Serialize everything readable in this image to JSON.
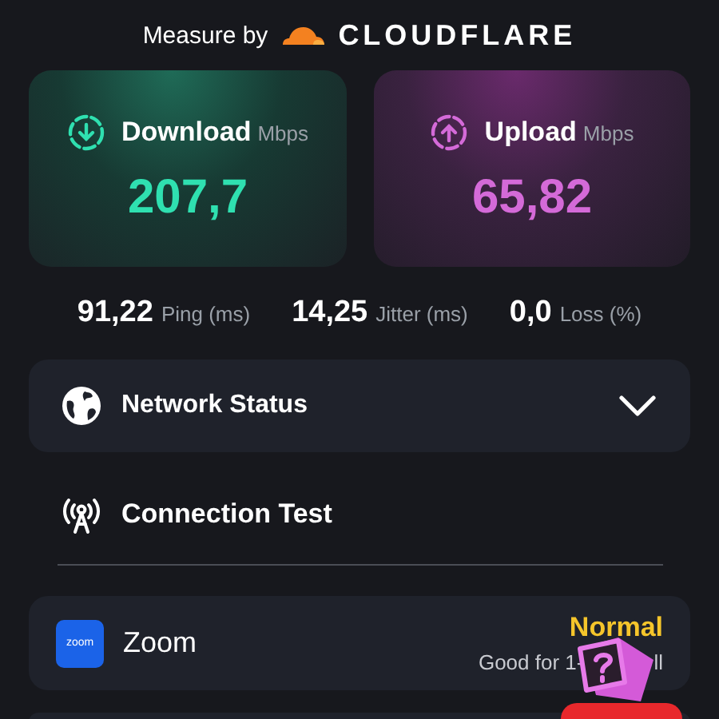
{
  "header": {
    "prefix": "Measure by",
    "brand": "CLOUDFLARE"
  },
  "speeds": [
    {
      "kind": "download",
      "label": "Download",
      "unit": "Mbps",
      "value": "207,7"
    },
    {
      "kind": "upload",
      "label": "Upload",
      "unit": "Mbps",
      "value": "65,82"
    }
  ],
  "stats": [
    {
      "value": "91,22",
      "label": "Ping (ms)"
    },
    {
      "value": "14,25",
      "label": "Jitter (ms)"
    },
    {
      "value": "0,0",
      "label": "Loss (%)"
    }
  ],
  "network_status": {
    "label": "Network Status",
    "expanded": false
  },
  "connection_test": {
    "title": "Connection Test"
  },
  "apps": [
    {
      "logo": "zoom",
      "name": "Zoom",
      "status": "Normal",
      "color": "#f5c52b",
      "note_parts": [
        "Good for 1-",
        "ll"
      ]
    }
  ]
}
